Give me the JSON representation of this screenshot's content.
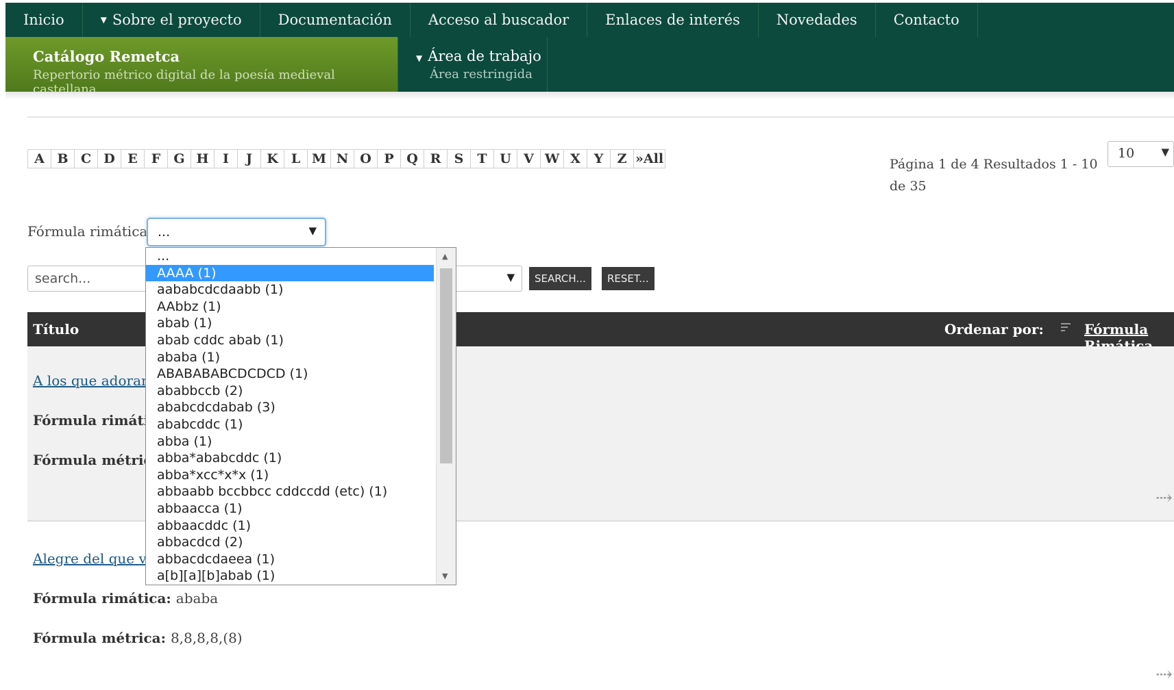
{
  "nav": {
    "row1": [
      {
        "label": "Inicio",
        "caret": false
      },
      {
        "label": "Sobre el proyecto",
        "caret": true
      },
      {
        "label": "Documentación",
        "caret": false
      },
      {
        "label": "Acceso al buscador",
        "caret": false
      },
      {
        "label": "Enlaces de interés",
        "caret": false
      },
      {
        "label": "Novedades",
        "caret": false
      },
      {
        "label": "Contacto",
        "caret": false
      }
    ],
    "brand_title": "Catálogo Remetca",
    "brand_subtitle": "Repertorio métrico digital de la poesía medieval castellana",
    "work_title": "Área de trabajo",
    "work_subtitle": "Área restringida",
    "colors": {
      "bar": "#0b4a3d",
      "brand": "#6f9a2a"
    }
  },
  "alphabet": [
    "A",
    "B",
    "C",
    "D",
    "E",
    "F",
    "G",
    "H",
    "I",
    "J",
    "K",
    "L",
    "M",
    "N",
    "O",
    "P",
    "Q",
    "R",
    "S",
    "T",
    "U",
    "V",
    "W",
    "X",
    "Y",
    "Z",
    "»All"
  ],
  "pagination": {
    "info": "Página 1 de 4 Resultados 1 - 10 de 35",
    "per_page": "10"
  },
  "filter": {
    "label": "Fórmula rimática:",
    "value": "...",
    "options": [
      "...",
      "AAAA (1)",
      "aababcdcdaabb (1)",
      "AAbbz (1)",
      "abab (1)",
      "abab cddc abab (1)",
      "ababa (1)",
      "ABABABABCDCDCD (1)",
      "ababbccb (2)",
      "ababcdcdabab (3)",
      "ababcddc (1)",
      "abba (1)",
      "abba*ababcddc (1)",
      "abba*xcc*x*x (1)",
      "abbaabb bccbbcc cddccdd (etc) (1)",
      "abbaacca (1)",
      "abbaacddc (1)",
      "abbacdcd (2)",
      "abbacdcdaeea (1)",
      "a[b][a][b]abab (1)"
    ],
    "selected_index": 1
  },
  "search": {
    "placeholder": "search...",
    "search_label": "SEARCH...",
    "reset_label": "RESET..."
  },
  "table": {
    "title_header": "Título",
    "order_label": "Ordenar por:",
    "order_link": "Fórmula Rimática"
  },
  "results": [
    {
      "title": "A los que adoran",
      "rima_label": "Fórmula rimática",
      "rima_value": "",
      "metrica_label": "Fórmula métrica:",
      "metrica_value": ""
    },
    {
      "title": "Alegre del que vo",
      "rima_label": "Fórmula rimática:",
      "rima_value": "ababa",
      "metrica_label": "Fórmula métrica:",
      "metrica_value": "8,8,8,8,(8)"
    }
  ],
  "icons": {
    "next": "next-arrow-icon",
    "sort": "sort-icon",
    "caret": "caret-down-icon"
  }
}
